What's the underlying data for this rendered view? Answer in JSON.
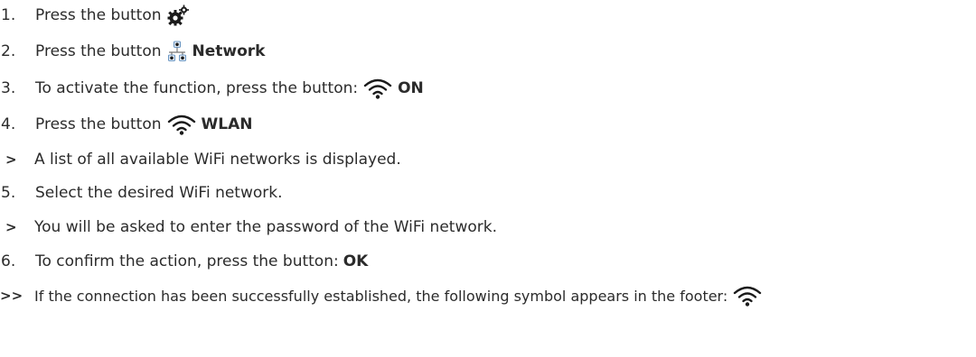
{
  "steps": [
    {
      "marker": "1.",
      "text": "Press the button",
      "icon": "gear-icon",
      "bold": ""
    },
    {
      "marker": "2.",
      "text": "Press the button",
      "icon": "network-icon",
      "bold": "Network"
    },
    {
      "marker": "3.",
      "text": "To activate the function, press the button:",
      "icon": "wifi-icon",
      "bold": "ON"
    },
    {
      "marker": "4.",
      "text": "Press the button",
      "icon": "wifi-icon",
      "bold": "WLAN"
    },
    {
      "marker": ">",
      "text": "A list of all available WiFi networks is displayed.",
      "icon": "",
      "bold": ""
    },
    {
      "marker": "5.",
      "text": "Select the desired WiFi network.",
      "icon": "",
      "bold": ""
    },
    {
      "marker": ">",
      "text": "You will be asked to enter the password of the WiFi network.",
      "icon": "",
      "bold": ""
    },
    {
      "marker": "6.",
      "text": "To confirm the action, press the button:",
      "icon": "",
      "bold": "OK"
    },
    {
      "marker": ">>",
      "text": "If the connection has been successfully established, the following symbol appears in the footer:",
      "icon": "wifi-icon",
      "bold": ""
    }
  ],
  "colors": {
    "text": "#2b2b2b",
    "icon": "#1a1a1a",
    "network_node": "#4a7fb5"
  }
}
